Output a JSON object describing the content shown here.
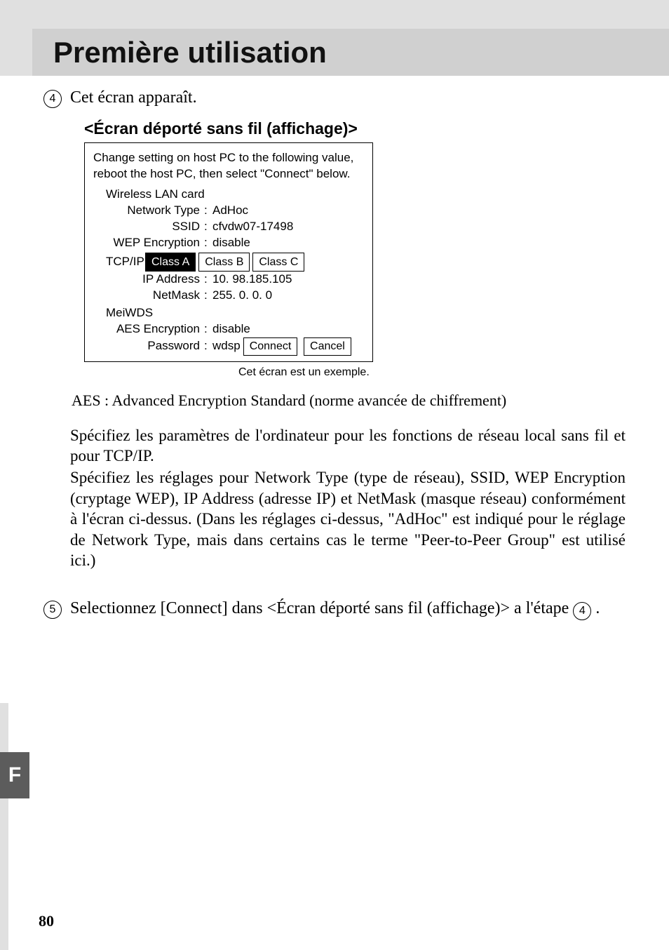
{
  "header": {
    "title": "Première utilisation"
  },
  "step4": {
    "marker": "4",
    "text": "Cet écran apparaît.",
    "subheading": "<Écran déporté sans fil (affichage)>"
  },
  "dialog": {
    "intro": "Change setting on host PC to the following value, reboot the host PC, then select \"Connect\" below.",
    "wlan_heading": "Wireless LAN card",
    "network_type": {
      "label": "Network Type",
      "value": "AdHoc"
    },
    "ssid": {
      "label": "SSID",
      "value": "cfvdw07-17498"
    },
    "wep": {
      "label": "WEP Encryption",
      "value": "disable"
    },
    "tcpip_label": "TCP/IP",
    "classes": {
      "a": "Class A",
      "b": "Class B",
      "c": "Class C"
    },
    "ip": {
      "label": "IP Address",
      "value": "  10. 98.185.105"
    },
    "netmask": {
      "label": "NetMask",
      "value": "255.   0.    0.   0"
    },
    "meiwds_heading": "MeiWDS",
    "aes": {
      "label": "AES Encryption",
      "value": "disable"
    },
    "password": {
      "label": "Password",
      "value": "wdsp"
    },
    "connect_btn": "Connect",
    "cancel_btn": "Cancel"
  },
  "example_note": "Cet écran est un exemple.",
  "aes_def": "AES   : Advanced Encryption Standard (norme avancée de chiffrement)",
  "para1": "Spécifiez les paramètres de l'ordinateur pour les fonctions de réseau local sans fil et pour TCP/IP.",
  "para2": "Spécifiez les réglages pour Network Type (type de réseau), SSID, WEP Encryption (cryptage WEP), IP Address (adresse IP) et NetMask (masque réseau) conformément à l'écran ci-dessus. (Dans les réglages ci-dessus, \"AdHoc\" est indiqué pour le réglage de Network Type, mais dans certains cas le terme \"Peer-to-Peer Group\" est utilisé ici.)",
  "step5": {
    "marker": "5",
    "pre": "Selectionnez [Connect] dans <Écran déporté sans fil (affichage)> a l'étape ",
    "ref": "4",
    "post": "."
  },
  "side_tab": "F",
  "page_number": "80"
}
